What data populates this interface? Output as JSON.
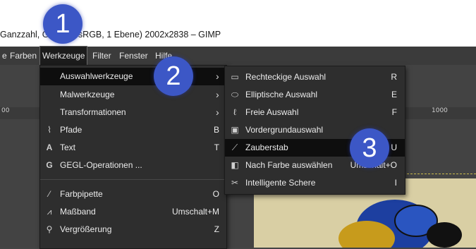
{
  "window": {
    "title": "Ganzzahl, GIMP … sRGB, 1 Ebene) 2002x2838 – GIMP"
  },
  "menubar": {
    "items": [
      "e",
      "Farben",
      "Werkzeuge",
      "Filter",
      "Fenster",
      "Hilfe"
    ],
    "active": "Werkzeuge"
  },
  "ruler": {
    "ticks": [
      "00",
      "1000"
    ]
  },
  "tools_menu": {
    "items": [
      {
        "label": "Auswahlwerkzeuge",
        "submenu": true,
        "highlighted": true
      },
      {
        "label": "Malwerkzeuge",
        "submenu": true
      },
      {
        "label": "Transformationen",
        "submenu": true
      },
      {
        "label": "Pfade",
        "shortcut": "B",
        "icon": "paths-icon"
      },
      {
        "label": "Text",
        "shortcut": "T",
        "icon": "text-icon"
      },
      {
        "label": "GEGL-Operationen ...",
        "icon": "gegl-icon"
      },
      {
        "label": "Farbpipette",
        "shortcut": "O",
        "icon": "color-picker-icon"
      },
      {
        "label": "Maßband",
        "shortcut": "Umschalt+M",
        "icon": "measure-icon"
      },
      {
        "label": "Vergrößerung",
        "shortcut": "Z",
        "icon": "zoom-icon"
      }
    ]
  },
  "selection_menu": {
    "items": [
      {
        "label": "Rechteckige Auswahl",
        "shortcut": "R",
        "icon": "rect-select-icon"
      },
      {
        "label": "Elliptische Auswahl",
        "shortcut": "E",
        "icon": "ellipse-select-icon"
      },
      {
        "label": "Freie Auswahl",
        "shortcut": "F",
        "icon": "lasso-icon"
      },
      {
        "label": "Vordergrundauswahl",
        "icon": "foreground-select-icon"
      },
      {
        "label": "Zauberstab",
        "shortcut": "U",
        "icon": "magic-wand-icon",
        "highlighted": true
      },
      {
        "label": "Nach Farbe auswählen",
        "shortcut": "Umschalt+O",
        "icon": "select-by-color-icon"
      },
      {
        "label": "Intelligente Schere",
        "shortcut": "I",
        "icon": "scissors-icon"
      }
    ]
  },
  "callouts": [
    "1",
    "2",
    "3"
  ],
  "colors": {
    "menu_bg": "#2e2e2e",
    "highlight": "#0e0e0e",
    "badge": "#3c57c6",
    "canvas": "#d9cfa4"
  }
}
